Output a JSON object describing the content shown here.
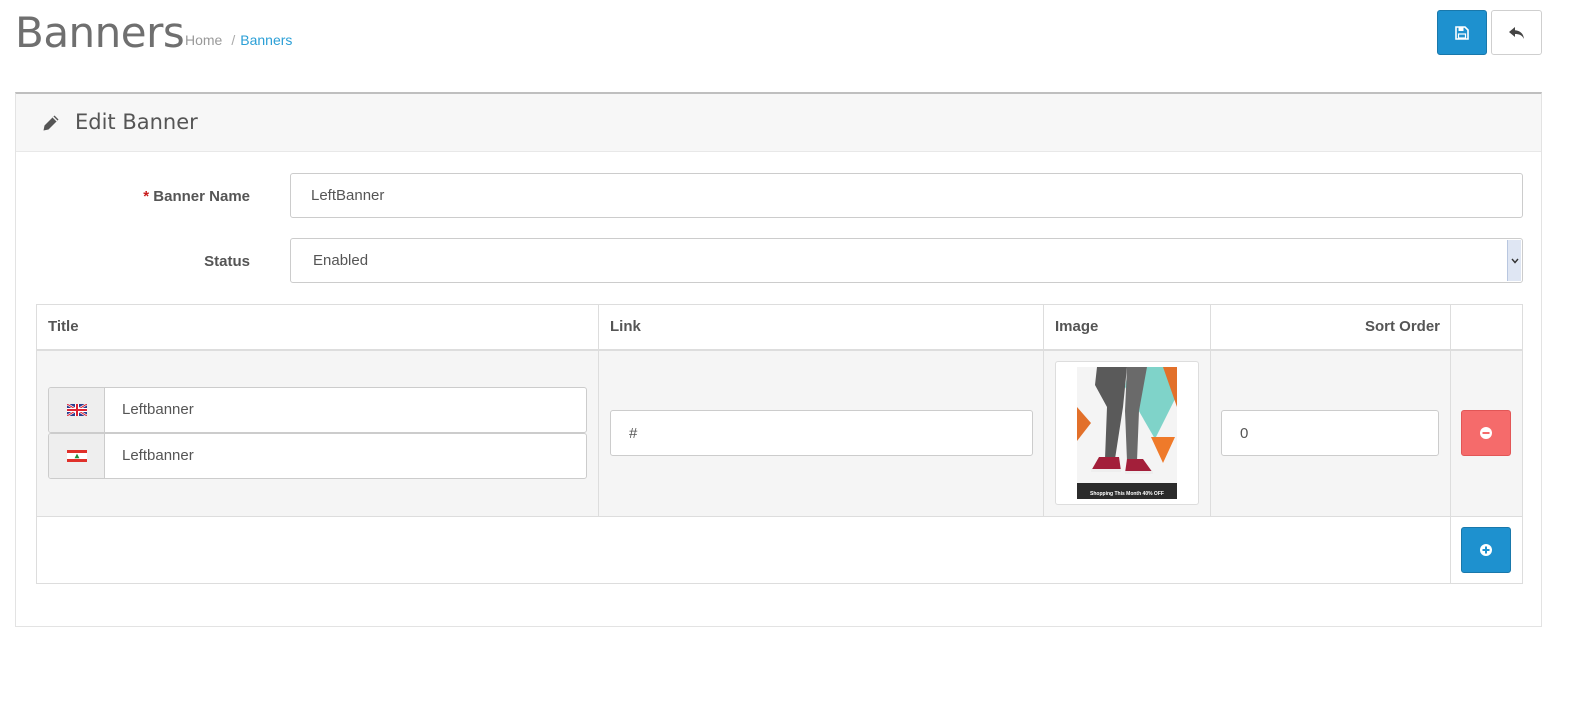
{
  "header": {
    "title": "Banners",
    "breadcrumb": [
      {
        "label": "Home"
      },
      {
        "label": "Banners"
      }
    ]
  },
  "toolbar": {
    "save_icon": "floppy-disk-icon",
    "back_icon": "reply-arrow-icon"
  },
  "panel": {
    "title": "Edit Banner",
    "icon": "pencil-icon"
  },
  "form": {
    "banner_name": {
      "required_mark": "*",
      "label": "Banner Name",
      "value": "LeftBanner"
    },
    "status": {
      "label": "Status",
      "value": "Enabled"
    }
  },
  "images_table": {
    "columns": [
      "Title",
      "Link",
      "Image",
      "Sort Order"
    ],
    "rows": [
      {
        "titles": [
          {
            "flag": "uk-flag-icon",
            "value": "Leftbanner"
          },
          {
            "flag": "lebanon-flag-icon",
            "value": "Leftbanner"
          }
        ],
        "link": "#",
        "image_caption": "Shopping This Month 40% OFF",
        "sort_order": "0"
      }
    ]
  },
  "colors": {
    "primary": "#1e91cf",
    "danger": "#f56b6b",
    "link": "#2b9fd6",
    "required": "#c91c1c"
  }
}
